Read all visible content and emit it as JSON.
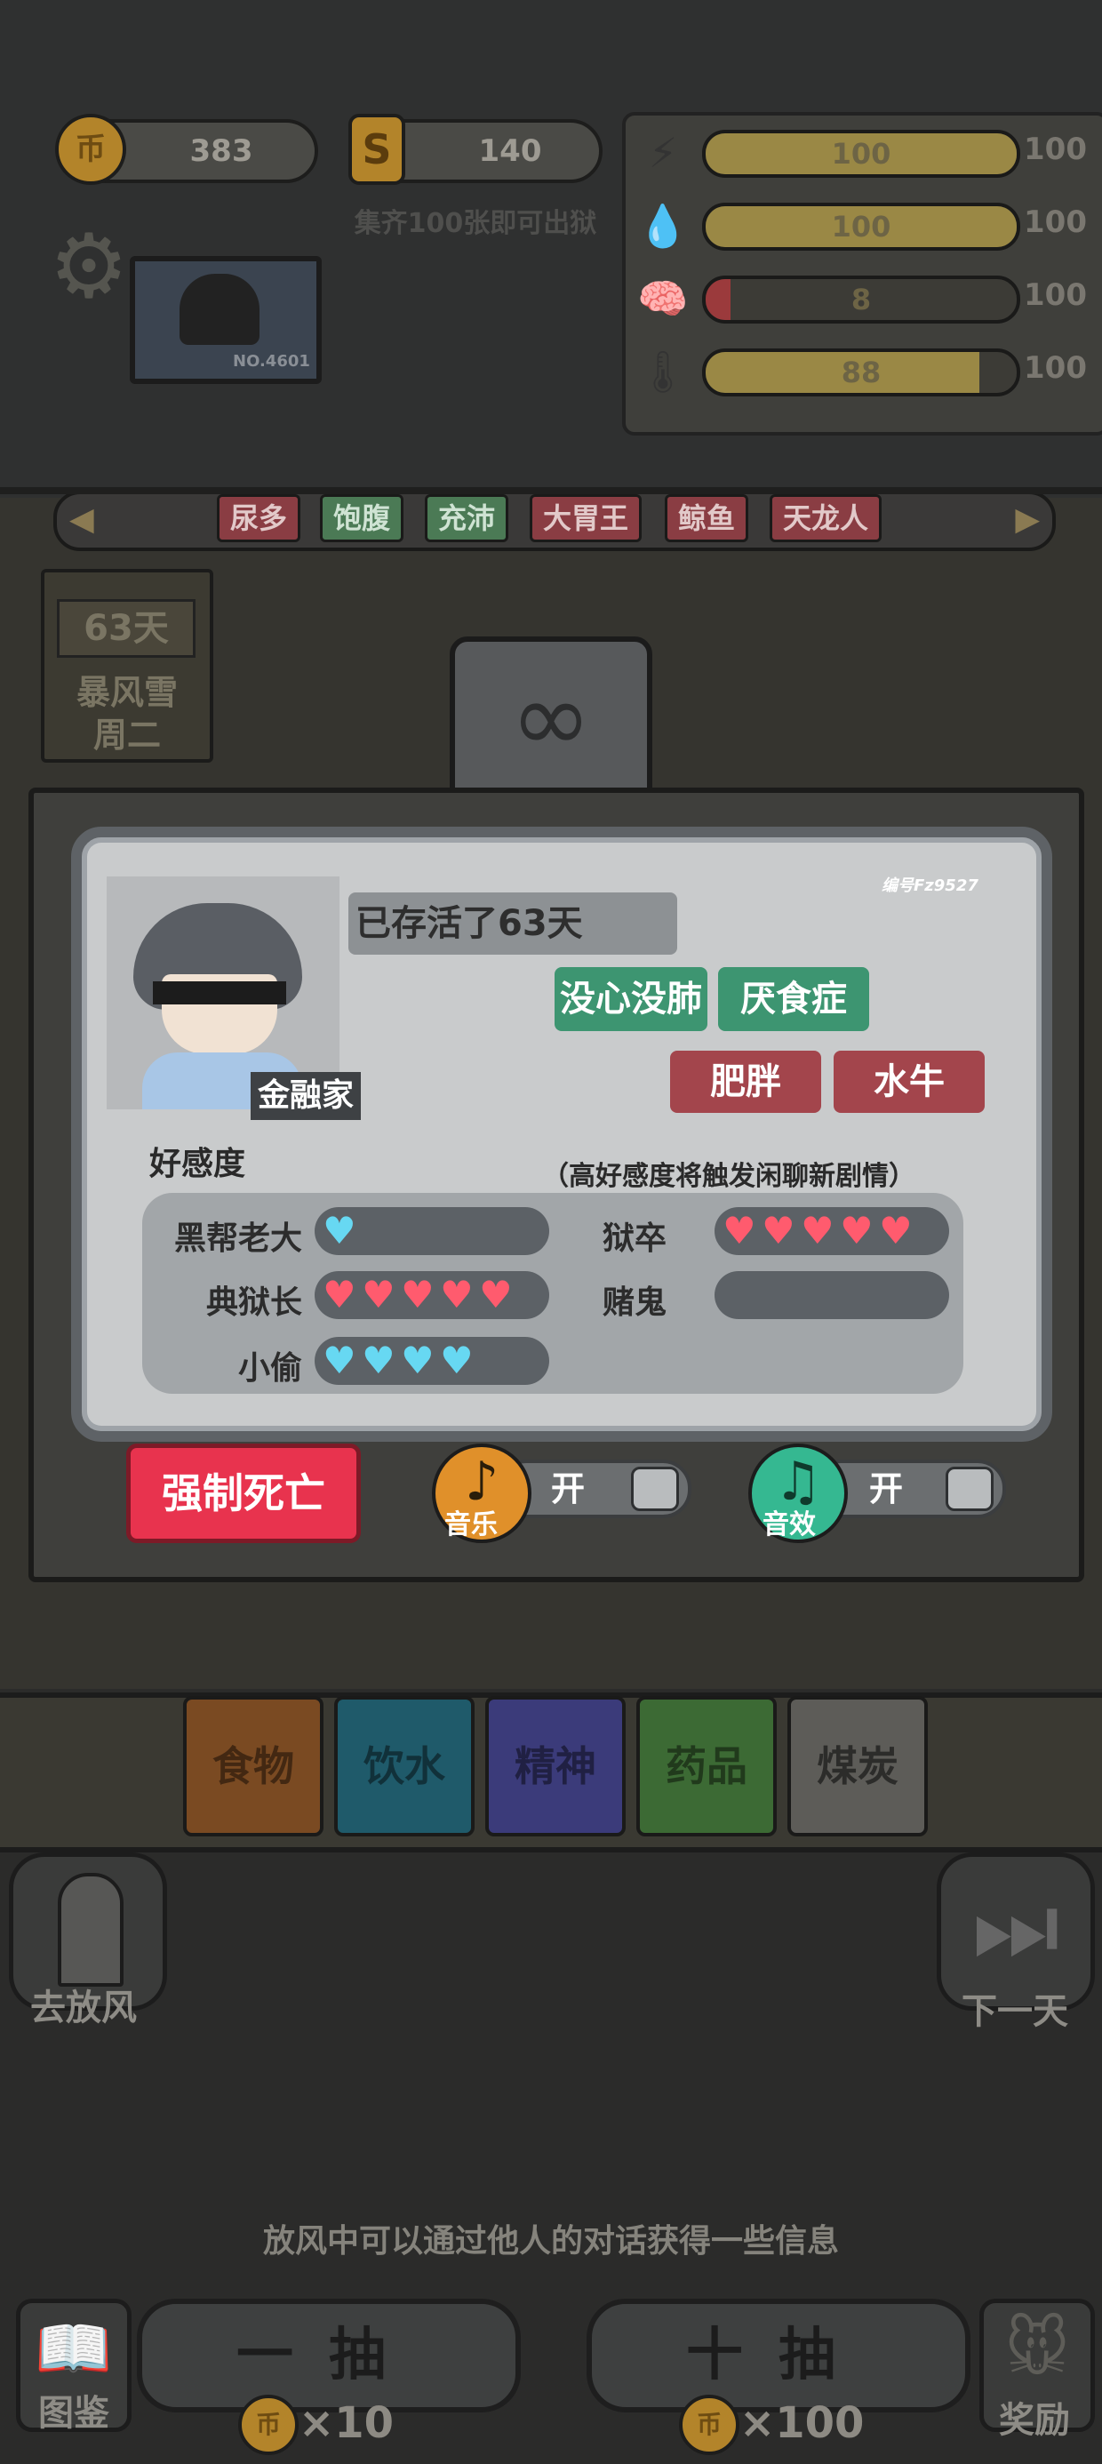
{
  "currency": {
    "coin_icon": "币",
    "coins": "383",
    "tickets_icon": "S",
    "tickets": "140",
    "hint": "集齐100张即可出狱"
  },
  "stats": [
    {
      "icon": "lightning-icon",
      "glyph": "⚡",
      "value": "100",
      "max": "100",
      "fraction": 1.0,
      "color": "#9a8845"
    },
    {
      "icon": "water-drop-icon",
      "glyph": "💧",
      "value": "100",
      "max": "100",
      "fraction": 1.0,
      "color": "#9a8845"
    },
    {
      "icon": "brain-icon",
      "glyph": "🧠",
      "value": "8",
      "max": "100",
      "fraction": 0.08,
      "color": "#9b3a3c"
    },
    {
      "icon": "thermometer-icon",
      "glyph": "🌡",
      "value": "88",
      "max": "100",
      "fraction": 0.88,
      "color": "#9a8845"
    }
  ],
  "prisoner_card": {
    "number": "NO.4601"
  },
  "tags": [
    "尿多",
    "饱腹",
    "充沛",
    "大胃王",
    "鲸鱼",
    "天龙人"
  ],
  "calendar": {
    "day": "63天",
    "weather": "暴风雪",
    "weekday": "周二"
  },
  "profile": {
    "serial": "编号Fz9527",
    "survival": "已存活了63天",
    "role": "金融家",
    "traits_positive": [
      "没心没肺",
      "厌食症"
    ],
    "traits_negative": [
      "肥胖",
      "水牛"
    ],
    "affinity_title": "好感度",
    "affinity_hint": "（高好感度将触发闲聊新剧情）",
    "affinity": [
      {
        "name": "黑帮老大",
        "hearts": 1,
        "color": "blue"
      },
      {
        "name": "狱卒",
        "hearts": 5,
        "color": "red"
      },
      {
        "name": "典狱长",
        "hearts": 5,
        "color": "red"
      },
      {
        "name": "赌鬼",
        "hearts": 0,
        "color": "red"
      },
      {
        "name": "小偷",
        "hearts": 4,
        "color": "blue"
      }
    ]
  },
  "controls": {
    "force_death": "强制死亡",
    "music_label": "音乐",
    "music_state": "开",
    "sfx_label": "音效",
    "sfx_state": "开"
  },
  "categories": [
    "食物",
    "饮水",
    "精神",
    "药品",
    "煤炭"
  ],
  "nav": {
    "yard": "去放风",
    "next_day": "下一天"
  },
  "tip": "放风中可以通过他人的对话获得一些信息",
  "draw": {
    "single": "一抽",
    "single_cost": "×10",
    "ten": "十抽",
    "ten_cost": "×100",
    "album": "图鉴",
    "reward": "奖励"
  }
}
